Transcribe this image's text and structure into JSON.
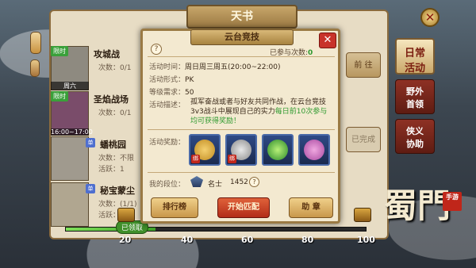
{
  "header": {
    "title": "天书"
  },
  "rows": [
    {
      "tag": "限时",
      "when": "周六",
      "title": "攻城战",
      "count": "次数：0/1",
      "action": ""
    },
    {
      "tag": "限时",
      "when": "16:00~17:00",
      "title": "圣焰战场",
      "count": "次数：0/1",
      "action": ""
    },
    {
      "tag": "单",
      "when": "",
      "title": "蟠桃园",
      "count": "次数：不限",
      "action": "活跃：1"
    },
    {
      "tag": "单",
      "when": "",
      "title": "秘宝蒙尘",
      "count": "次数：(1/1)",
      "action": "活跃：1"
    }
  ],
  "row_buttons": {
    "go": "前 往",
    "done": "已完成"
  },
  "tabs": {
    "daily": "日常\n活动",
    "field": "野外\n首领",
    "hero": "侠义\n协助"
  },
  "progress": {
    "claimed_label": "已领取",
    "ticks": [
      "20",
      "40",
      "60",
      "80",
      "100"
    ],
    "value": 30
  },
  "logo": {
    "text": "蜀門",
    "seal": "手游"
  },
  "modal": {
    "title": "云台竞技",
    "joined_prefix": "已参与次数:",
    "joined_count": "0",
    "time_label": "活动时间：",
    "time_value": "周日周三周五(20:00~22:00)",
    "form_label": "活动形式：",
    "form_value": "PK",
    "level_label": "等级需求：",
    "level_value": "50",
    "desc_label": "活动描述：",
    "desc_text": "孤军奋战或者与好友共同作战，在云台竞技3v3战斗中展现自己的实力",
    "desc_highlight": "每日前10次参与均可获得奖励！",
    "reward_label": "活动奖励：",
    "rewards": [
      {
        "name": "scroll-reward",
        "bind": "绑"
      },
      {
        "name": "cloth-reward",
        "bind": "绑"
      },
      {
        "name": "orb-reward",
        "bind": ""
      },
      {
        "name": "ribbon-reward",
        "bind": ""
      }
    ],
    "rank_label": "我的段位：",
    "rank_name": "名士",
    "rank_value": "1452",
    "btn_rank": "排行榜",
    "btn_match": "开始匹配",
    "btn_help": "助 章"
  },
  "colors": {
    "accent": "#c8332a",
    "green": "#2f9a2f"
  }
}
